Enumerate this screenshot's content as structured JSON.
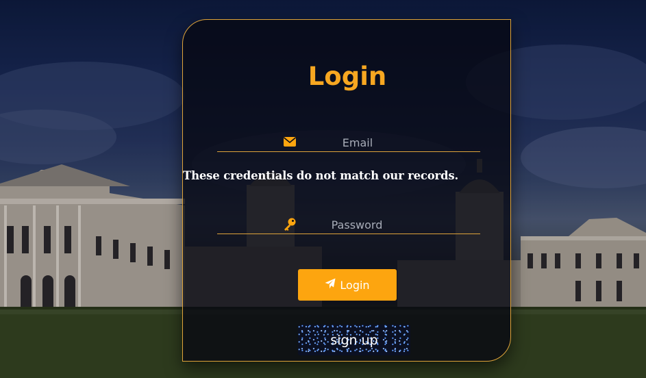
{
  "page": {
    "title": "Login"
  },
  "form": {
    "email": {
      "placeholder": "Email",
      "value": "",
      "icon": "envelope-icon"
    },
    "password": {
      "placeholder": "Password",
      "value": "",
      "icon": "key-icon"
    },
    "error_message": "These credentials do not match our records.",
    "login_button": {
      "label": "Login",
      "icon": "paper-plane-icon"
    },
    "signup_button": {
      "label": "sign up"
    }
  },
  "theme": {
    "accent": "#fda50f",
    "title_color": "#f7a721",
    "card_border": "#e0a43a",
    "error_text": "#ffffff"
  }
}
